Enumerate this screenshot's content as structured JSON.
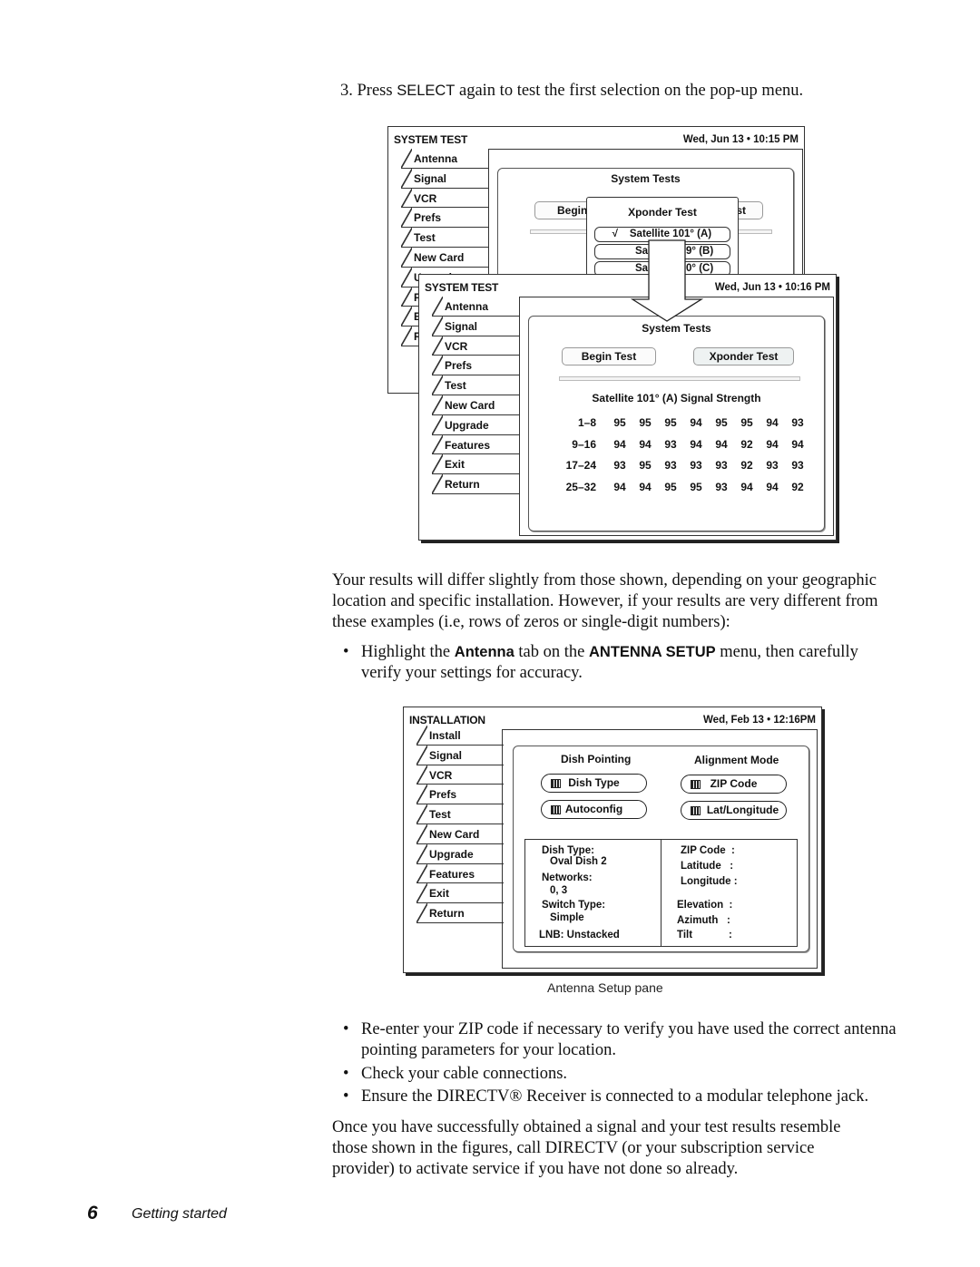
{
  "step": {
    "number": "3.",
    "prefix": "Press",
    "keyword": "SELECT",
    "suffix": "again to test the first selection on the pop-up menu."
  },
  "screen1": {
    "title": "SYSTEM TEST",
    "datetime": "Wed, Jun 13 • 10:15 PM",
    "tabs": [
      "Antenna",
      "Signal",
      "VCR",
      "Prefs",
      "Test",
      "New Card",
      "Upgrade",
      "Features",
      "Exit",
      "Return"
    ],
    "panel_title": "System Tests",
    "begin_button_partial": "Begin",
    "xponder_button_partial": "st",
    "popup": {
      "title": "Xponder Test",
      "options": [
        {
          "check": "√",
          "label": "Satellite 101° (A)",
          "selected": true
        },
        {
          "label_left": "Sa",
          "label_right": "9° (B)",
          "selected": false
        },
        {
          "label_left": "Sa",
          "label_right": "0° (C)",
          "selected": false
        }
      ]
    },
    "hidden_tab_initials": [
      "F",
      "E",
      "R"
    ]
  },
  "arrow": {
    "icon": "down-arrow-icon"
  },
  "screen2": {
    "title": "SYSTEM TEST",
    "datetime": "Wed, Jun 13 • 10:16 PM",
    "tabs": [
      "Antenna",
      "Signal",
      "VCR",
      "Prefs",
      "Test",
      "New Card",
      "Upgrade",
      "Features",
      "Exit",
      "Return"
    ],
    "panel_title": "System Tests",
    "buttons": {
      "begin": "Begin Test",
      "xponder": "Xponder Test"
    },
    "signal_title": "Satellite 101° (A) Signal Strength",
    "signal_rows": [
      {
        "label": "1–8",
        "values": [
          "95",
          "95",
          "95",
          "94",
          "95",
          "95",
          "94",
          "93"
        ]
      },
      {
        "label": "9–16",
        "values": [
          "94",
          "94",
          "93",
          "94",
          "94",
          "92",
          "94",
          "94"
        ]
      },
      {
        "label": "17–24",
        "values": [
          "93",
          "95",
          "93",
          "93",
          "93",
          "92",
          "93",
          "93"
        ]
      },
      {
        "label": "25–32",
        "values": [
          "94",
          "94",
          "95",
          "95",
          "93",
          "94",
          "94",
          "92"
        ]
      }
    ]
  },
  "para1": "Your results will differ slightly from those shown, depending on your geographic location and specific installation. However, if your results are very different from these examples (i.e, rows of zeros or single-digit numbers):",
  "bullet1": {
    "dot": "•",
    "pre": "Highlight the",
    "tab_name": "Antenna",
    "mid": "tab on the",
    "menu_name": "ANTENNA SETUP",
    "post": "menu, then carefully verify your settings for accuracy."
  },
  "screen3": {
    "title": "INSTALLATION",
    "datetime": "Wed, Feb 13 • 12:16PM",
    "tabs": [
      "Install",
      "Signal",
      "VCR",
      "Prefs",
      "Test",
      "New Card",
      "Upgrade",
      "Features",
      "Exit",
      "Return"
    ],
    "dish_pointing_title": "Dish Pointing",
    "alignment_mode_title": "Alignment Mode",
    "buttons": {
      "dish_type": "Dish Type",
      "autoconfig": "Autoconfig",
      "zip_code": "ZIP Code",
      "lat_longitude": "Lat/Longitude"
    },
    "info_left": {
      "dish_type_label": "Dish Type:",
      "dish_type_value": "Oval Dish 2",
      "networks_label": "Networks:",
      "networks_value": "0, 3",
      "switch_type_label": "Switch Type:",
      "switch_type_value": "Simple",
      "lnb": "LNB: Unstacked"
    },
    "info_right": {
      "zip_label": "ZIP Code  :",
      "latitude_label": "Latitude   :",
      "longitude_label": "Longitude :",
      "elevation_label": "Elevation  :",
      "azimuth_label": "Azimuth   :",
      "tilt_label": "Tilt",
      "tilt_colon": ":"
    },
    "caption": "Antenna Setup pane"
  },
  "bullets2": [
    "Re-enter your ZIP code if necessary to verify you have used the correct antenna pointing parameters for your location.",
    "Check your cable connections.",
    "Ensure the DIRECTV® Receiver is connected to a modular telephone jack."
  ],
  "para2": "Once you have successfully obtained a signal and your test results resemble those shown in the figures, call DIRECTV (or your subscription service provider) to activate service if you have not done so already.",
  "footer": {
    "page_number": "6",
    "section": "Getting started"
  }
}
